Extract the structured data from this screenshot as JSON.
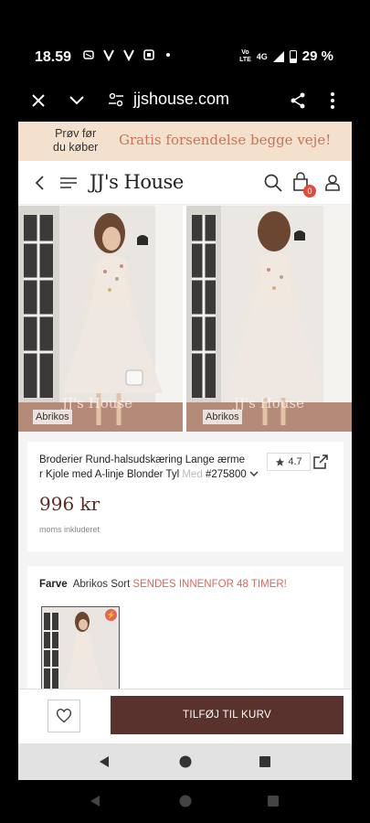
{
  "status_bar": {
    "time": "18.59",
    "network_top": "Vo",
    "network_bottom": "LTE",
    "network_type": "4G",
    "battery_percent": "29 %"
  },
  "browser": {
    "url": "jjshouse.com",
    "icons": [
      "close-icon",
      "chevron-down-icon",
      "site-settings-icon",
      "share-icon",
      "more-vert-icon"
    ]
  },
  "promo": {
    "left_line1": "Prøv før",
    "left_line2": "du køber",
    "right": "Gratis forsendelse begge veje!"
  },
  "header": {
    "logo": "JJ's House",
    "cart_count": "0",
    "icons": [
      "back-chevron-icon",
      "menu-icon",
      "search-icon",
      "cart-icon",
      "account-icon"
    ]
  },
  "gallery": {
    "images": [
      {
        "color_label": "Abrikos",
        "watermark": "JJ's House"
      },
      {
        "color_label": "Abrikos",
        "watermark": "JJ's House"
      }
    ]
  },
  "product": {
    "title_line1": "Broderier Rund-halsudskæring Lange ærme",
    "title_line2_start": "r Kjole med A-linje Blonder Tyl ",
    "title_line2_faded": "Med",
    "code": "#275800",
    "rating": "4.7",
    "price": "996 kr",
    "vat_note": "moms inkluderet"
  },
  "color": {
    "label": "Farve",
    "options": "Abrikos Sort",
    "shipping": "SENDES INNENFOR 48 TIMER!"
  },
  "actions": {
    "add_to_cart": "TILFØJ TIL KURV"
  },
  "colors": {
    "accent_brown": "#5a322d",
    "price_brown": "#5a2c27",
    "promo_bg": "#f3e1cd",
    "promo_text": "#c8735a",
    "shipping_red": "#cf6b60",
    "badge_red": "#e04b3b"
  }
}
